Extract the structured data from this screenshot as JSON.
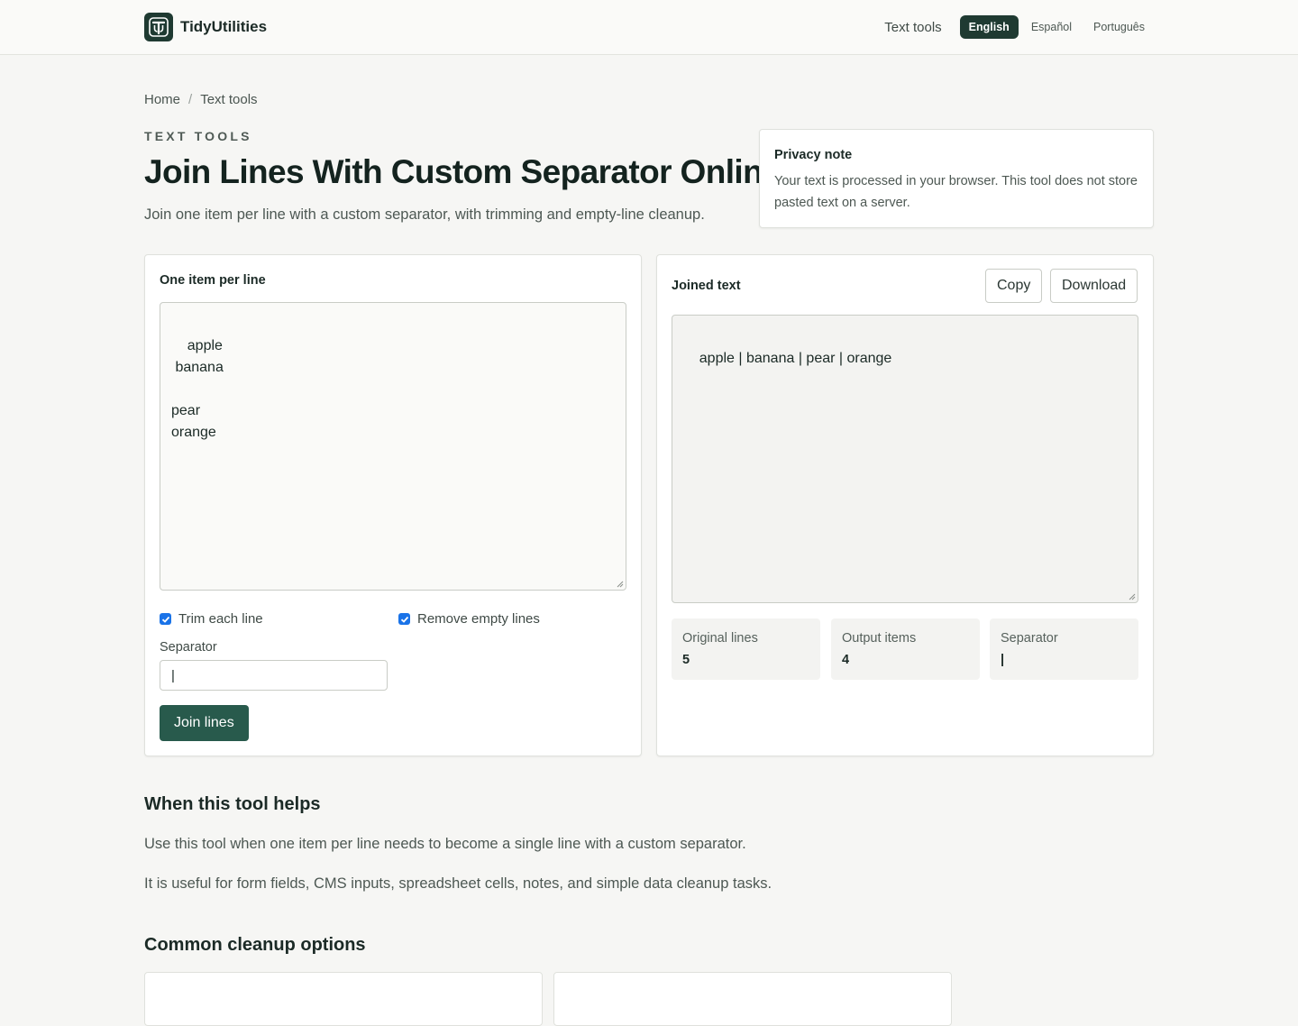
{
  "header": {
    "brand_name": "TidyUtilities",
    "nav_link": "Text tools",
    "languages": [
      "English",
      "Español",
      "Português"
    ],
    "active_language": "English"
  },
  "breadcrumb": {
    "home": "Home",
    "separator": "/",
    "current": "Text tools"
  },
  "hero": {
    "eyebrow": "TEXT TOOLS",
    "title": "Join Lines With Custom Separator Online",
    "subtitle": "Join one item per line with a custom separator, with trimming and empty-line cleanup."
  },
  "privacy": {
    "title": "Privacy note",
    "text": "Your text is processed in your browser. This tool does not store pasted text on a server."
  },
  "input_panel": {
    "label": "One item per line",
    "text": "apple\n banana\n\npear\norange",
    "trim_label": "Trim each line",
    "trim_checked": true,
    "remove_empty_label": "Remove empty lines",
    "remove_empty_checked": true,
    "separator_label": "Separator",
    "separator_value": "|",
    "join_button": "Join lines"
  },
  "output_panel": {
    "label": "Joined text",
    "copy_button": "Copy",
    "download_button": "Download",
    "text": "apple | banana | pear | orange",
    "stats": [
      {
        "label": "Original lines",
        "value": "5"
      },
      {
        "label": "Output items",
        "value": "4"
      },
      {
        "label": "Separator",
        "value": "|"
      }
    ]
  },
  "content": {
    "helps_heading": "When this tool helps",
    "helps_p1": "Use this tool when one item per line needs to become a single line with a custom separator.",
    "helps_p2": "It is useful for form fields, CMS inputs, spreadsheet cells, notes, and simple data cleanup tasks.",
    "options_heading": "Common cleanup options"
  },
  "colors": {
    "brand": "#1f3a32",
    "primary_button": "#285a4c",
    "checkbox": "#1a73e8",
    "background": "#f6f6f4"
  }
}
